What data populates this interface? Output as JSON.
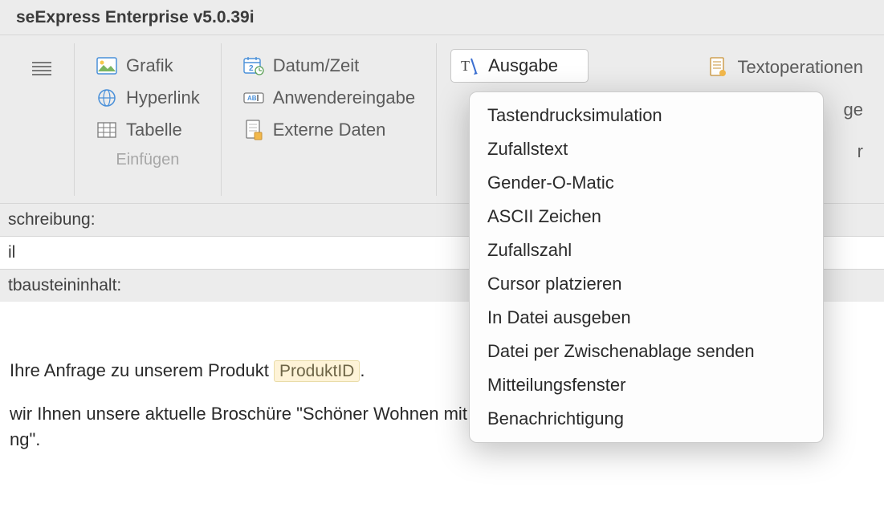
{
  "title": "seExpress Enterprise v5.0.39i",
  "toolbar": {
    "group1": {
      "grafik": "Grafik",
      "hyperlink": "Hyperlink",
      "tabelle": "Tabelle",
      "label": "Einfügen"
    },
    "group2": {
      "datumzeit": "Datum/Zeit",
      "anwendereingabe": "Anwendereingabe",
      "externedaten": "Externe Daten"
    },
    "group3": {
      "ausgabe": "Ausgabe"
    },
    "group4": {
      "textoperationen": "Textoperationen",
      "partial1": "ge",
      "partial2": "r"
    }
  },
  "dropdown": {
    "items": [
      "Tastendrucksimulation",
      "Zufallstext",
      "Gender-O-Matic",
      "ASCII Zeichen",
      "Zufallszahl",
      "Cursor platzieren",
      "In Datei ausgeben",
      "Datei per Zwischenablage senden",
      "Mitteilungsfenster",
      "Benachrichtigung"
    ]
  },
  "form": {
    "beschreibung_label": "schreibung:",
    "beschreibung_value": "il",
    "inhalt_label": "tbausteininhalt:"
  },
  "body": {
    "line1_pre": "Ihre Anfrage zu unserem Produkt ",
    "placeholder": "ProduktID",
    "line1_post": ".",
    "line2": " wir Ihnen unsere aktuelle Broschüre \"Schöner Wohnen mit plastikähnlicher",
    "line3": "ng\"."
  }
}
